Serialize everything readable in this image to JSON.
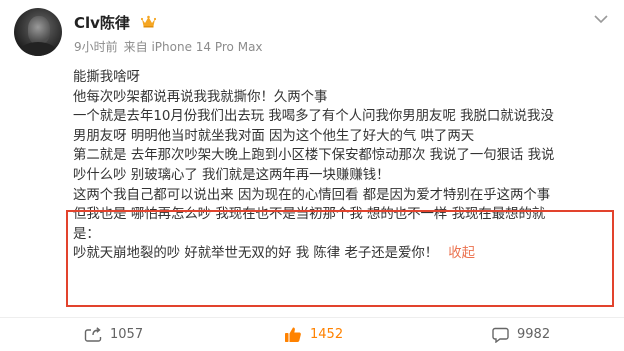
{
  "post": {
    "author": "Clv陈律",
    "time": "9小时前",
    "source": "来自 iPhone 14 Pro Max",
    "lines": [
      "能撕我啥呀",
      "他每次吵架都说再说我我就撕你！久两个事",
      "一个就是去年10月份我们出去玩 我喝多了有个人问我你男朋友呢 我脱口就说我没",
      "男朋友呀 明明他当时就坐我对面 因为这个他生了好大的气 哄了两天",
      "第二就是 去年那次吵架大晚上跑到小区楼下保安都惊动那次 我说了一句狠话 我说",
      "吵什么吵 别玻璃心了 我们就是这两年再一块赚赚钱！",
      "这两个我自己都可以说出来 因为现在的心情回看 都是因为爱才特别在乎这两个事",
      "但我也是 哪怕再怎么吵 我现在也不是当初那个我 想的也不一样 我现在最想的就",
      "是：",
      "吵就天崩地裂的吵 好就举世无双的好 我 陈律 老子还是爱你！"
    ],
    "collapse_label": "收起"
  },
  "actions": {
    "repost_count": "1057",
    "like_count": "1452",
    "comment_count": "9982"
  },
  "colors": {
    "accent": "#ff8200",
    "collapse": "#eb7350",
    "highlight_border": "#e2432d"
  },
  "icons": [
    "crown-badge-icon",
    "chevron-down-icon",
    "repost-icon",
    "comment-icon",
    "like-icon"
  ]
}
